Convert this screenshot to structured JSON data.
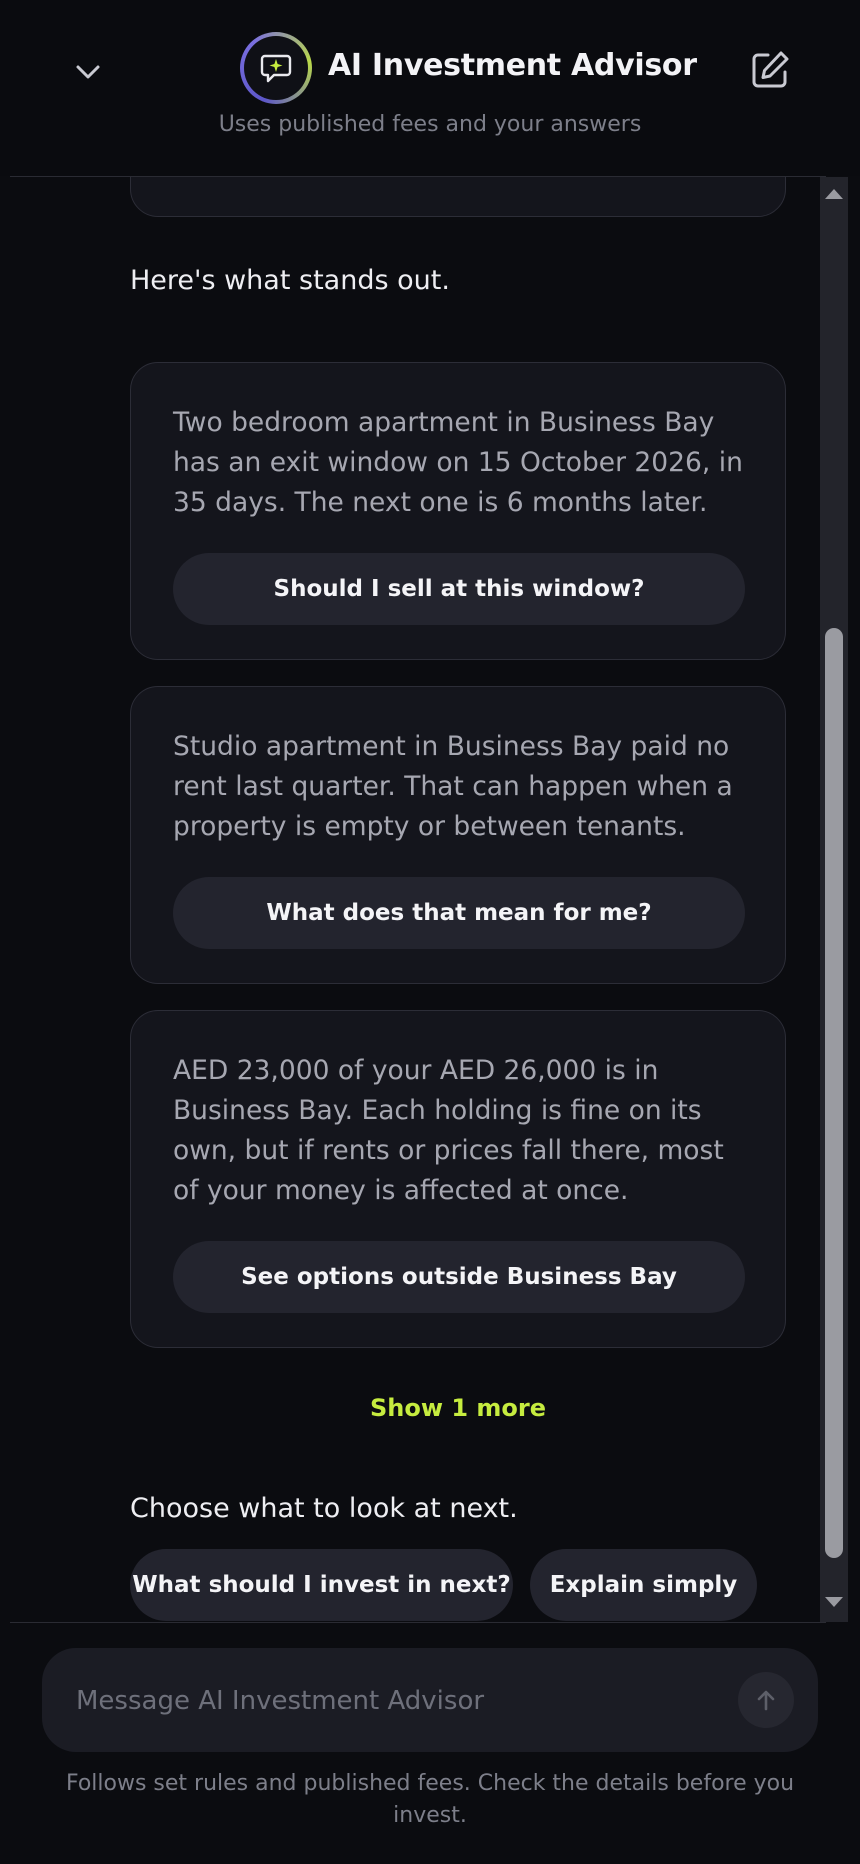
{
  "header": {
    "title": "AI Investment Advisor",
    "subtitle": "Uses published fees and your answers",
    "icons": {
      "collapse": "chevron-down-icon",
      "logo": "chat-sparkle-icon",
      "new_chat": "edit-icon"
    }
  },
  "chat": {
    "intro": "Here's what stands out.",
    "cards": [
      {
        "text": "Two bedroom apartment in Business Bay has an exit window on 15 October 2026, in 35 days. The next one is 6 months later.",
        "button": "Should I sell at this window?"
      },
      {
        "text": "Studio apartment in Business Bay paid no rent last quarter. That can happen when a property is empty or between tenants.",
        "button": "What does that mean for me?"
      },
      {
        "text": "AED 23,000 of your AED 26,000 is in Business Bay. Each holding is fine on its own, but if rents or prices fall there, most of your money is affected at once.",
        "button": "See options outside Business Bay"
      }
    ],
    "show_more": "Show 1 more",
    "next_prompt": "Choose what to look at next.",
    "suggestions": [
      "What should I invest in next?",
      "Explain simply"
    ]
  },
  "composer": {
    "placeholder": "Message AI Investment Advisor",
    "send_icon": "arrow-up-icon"
  },
  "footnote": "Follows set rules and published fees. Check the details before you invest.",
  "colors": {
    "background": "#0b0c10",
    "card": "#14151c",
    "button": "#23242e",
    "accent": "#c6ec3f"
  }
}
